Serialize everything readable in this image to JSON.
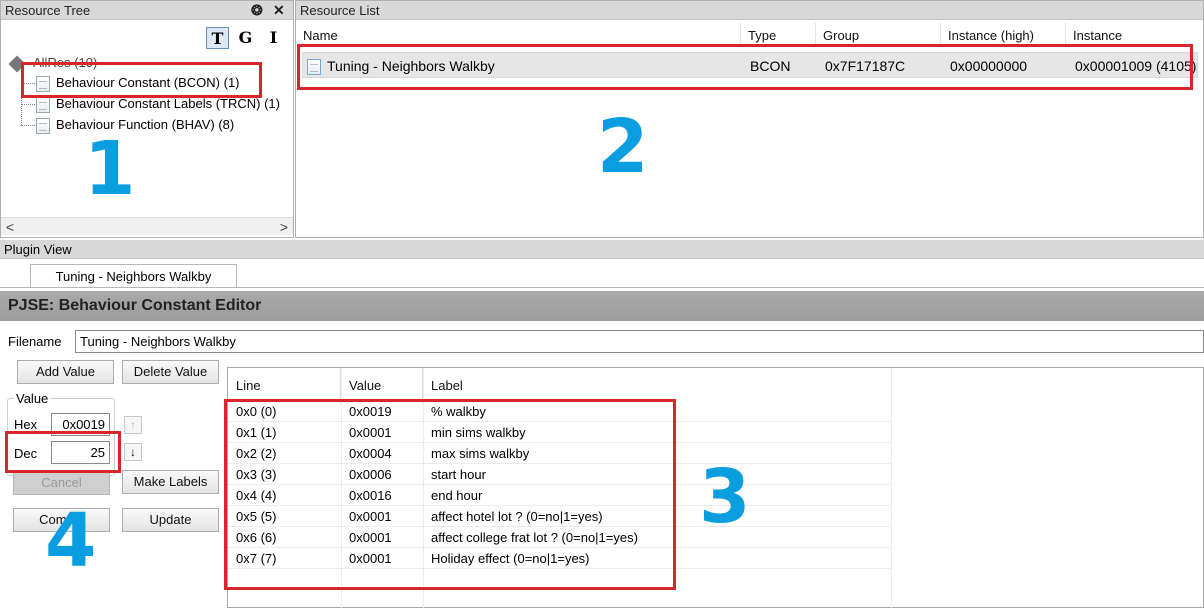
{
  "resource_tree": {
    "title": "Resource Tree",
    "pin_glyph": "❂",
    "close_glyph": "✕",
    "toolbar": [
      "T",
      "G",
      "I"
    ],
    "root": "AllRes (10)",
    "items": [
      "Behaviour Constant (BCON) (1)",
      "Behaviour Constant Labels (TRCN) (1)",
      "Behaviour Function (BHAV) (8)"
    ],
    "scroll_left": "<",
    "scroll_right": ">"
  },
  "resource_list": {
    "title": "Resource List",
    "columns": [
      "Name",
      "Type",
      "Group",
      "Instance (high)",
      "Instance"
    ],
    "rows": [
      {
        "name": "Tuning - Neighbors Walkby",
        "type": "BCON",
        "group": "0x7F17187C",
        "instance_high": "0x00000000",
        "instance": "0x00001009 (4105)"
      }
    ]
  },
  "plugin_view": {
    "title": "Plugin View",
    "tab": "Tuning - Neighbors Walkby",
    "editor_title": "PJSE: Behaviour Constant Editor",
    "filename_label": "Filename",
    "filename_value": "Tuning - Neighbors Walkby",
    "add_value": "Add Value",
    "delete_value": "Delete Value",
    "value_group": "Value",
    "hex_label": "Hex",
    "hex_value": "0x0019",
    "dec_label": "Dec",
    "dec_value": "25",
    "up_glyph": "↑",
    "down_glyph": "↓",
    "cancel": "Cancel",
    "make_labels": "Make Labels",
    "commit": "Commit",
    "update": "Update",
    "table": {
      "columns": [
        "Line",
        "Value",
        "Label"
      ],
      "rows": [
        {
          "line": "0x0 (0)",
          "value": "0x0019",
          "label": "% walkby"
        },
        {
          "line": "0x1 (1)",
          "value": "0x0001",
          "label": "min sims walkby"
        },
        {
          "line": "0x2 (2)",
          "value": "0x0004",
          "label": "max sims walkby"
        },
        {
          "line": "0x3 (3)",
          "value": "0x0006",
          "label": "start hour"
        },
        {
          "line": "0x4 (4)",
          "value": "0x0016",
          "label": "end hour"
        },
        {
          "line": "0x5 (5)",
          "value": "0x0001",
          "label": "affect hotel lot ? (0=no|1=yes)"
        },
        {
          "line": "0x6 (6)",
          "value": "0x0001",
          "label": "affect college frat lot ? (0=no|1=yes)"
        },
        {
          "line": "0x7 (7)",
          "value": "0x0001",
          "label": "Holiday effect (0=no|1=yes)"
        }
      ]
    }
  },
  "annotations": [
    "1",
    "2",
    "3",
    "4"
  ],
  "colors": {
    "annotation_box": "#d9262c",
    "annotation_number": "#0a9ee0"
  }
}
